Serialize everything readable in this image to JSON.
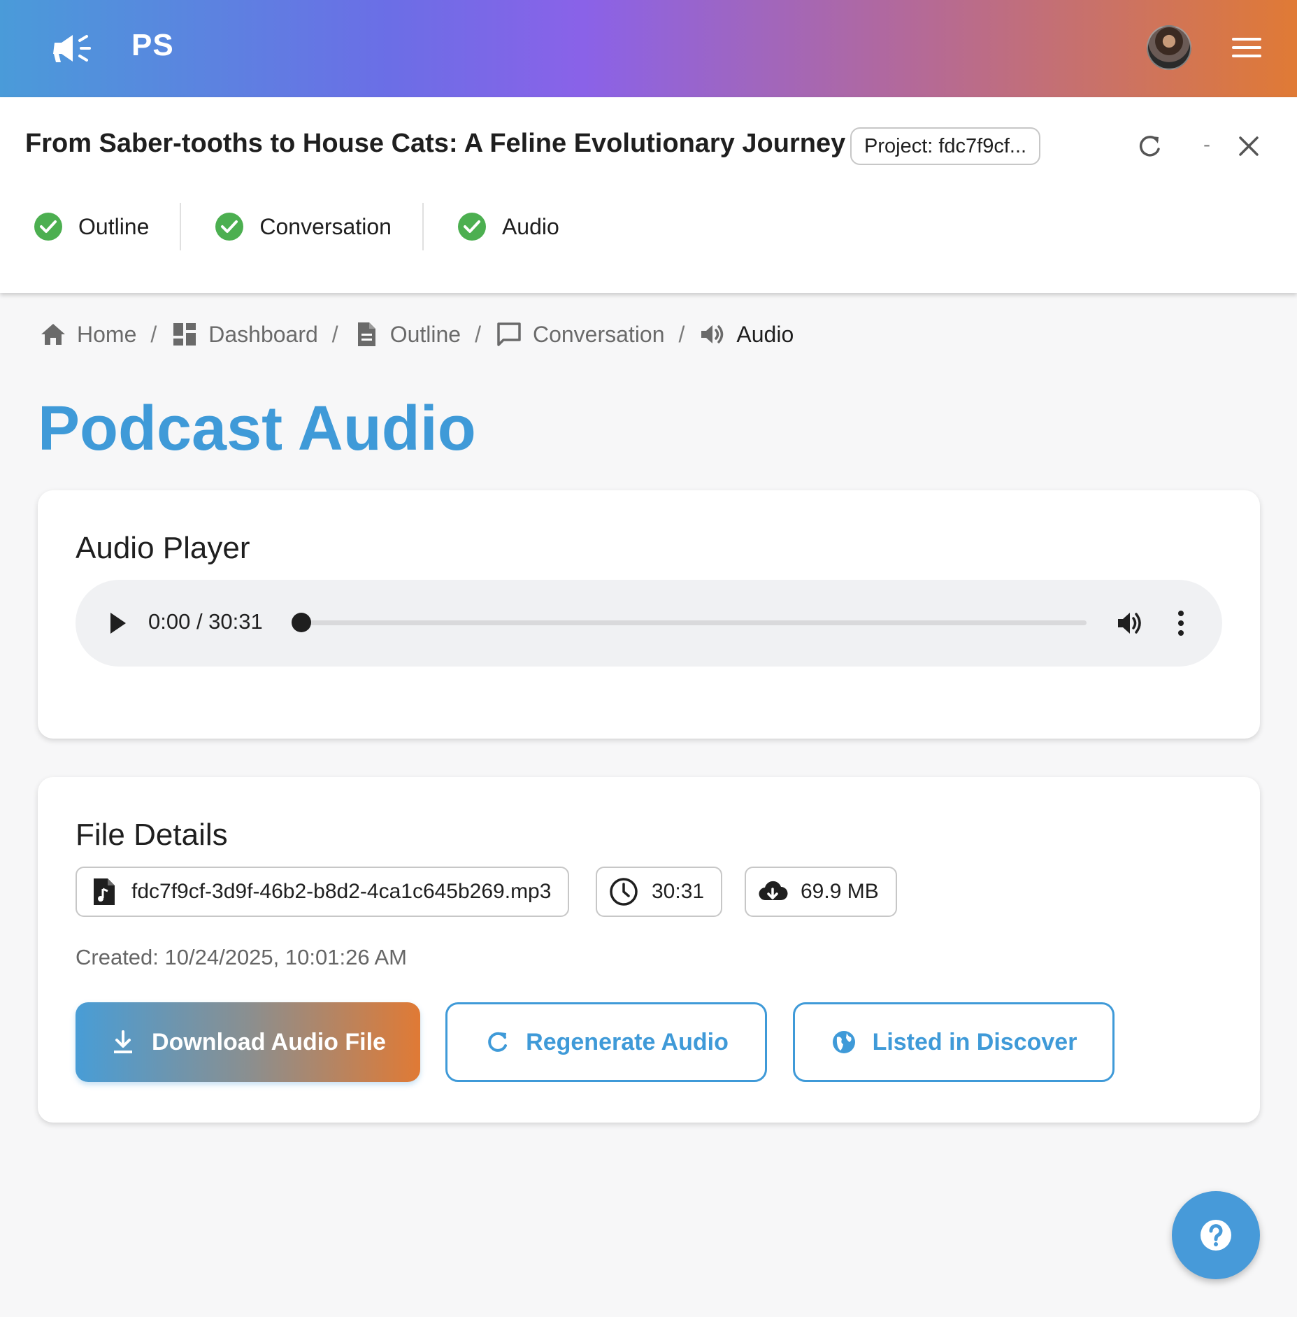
{
  "appbar": {
    "brand": "PS"
  },
  "project": {
    "title": "From Saber-tooths to House Cats: A Feline Evolutionary Journey",
    "chip": "Project: fdc7f9cf...",
    "minimize_label": "-"
  },
  "steps": [
    {
      "label": "Outline"
    },
    {
      "label": "Conversation"
    },
    {
      "label": "Audio"
    }
  ],
  "breadcrumb": {
    "items": [
      {
        "label": "Home",
        "icon": "home-icon"
      },
      {
        "label": "Dashboard",
        "icon": "dashboard-icon"
      },
      {
        "label": "Outline",
        "icon": "document-icon"
      },
      {
        "label": "Conversation",
        "icon": "chat-icon"
      },
      {
        "label": "Audio",
        "icon": "speaker-icon"
      }
    ],
    "separator": "/"
  },
  "page": {
    "title": "Podcast Audio"
  },
  "player": {
    "heading": "Audio Player",
    "time": "0:00 / 30:31",
    "progress": 0
  },
  "file_details": {
    "heading": "File Details",
    "filename": "fdc7f9cf-3d9f-46b2-b8d2-4ca1c645b269.mp3",
    "duration": "30:31",
    "size": "69.9 MB",
    "created": "Created: 10/24/2025, 10:01:26 AM"
  },
  "actions": {
    "download": "Download Audio File",
    "regenerate": "Regenerate Audio",
    "discover": "Listed in Discover"
  },
  "colors": {
    "accent": "#3f9ad8",
    "success": "#4caf50",
    "gradient_start": "#4a9bd9",
    "gradient_mid": "#8a62e8",
    "gradient_end": "#e07a35"
  }
}
